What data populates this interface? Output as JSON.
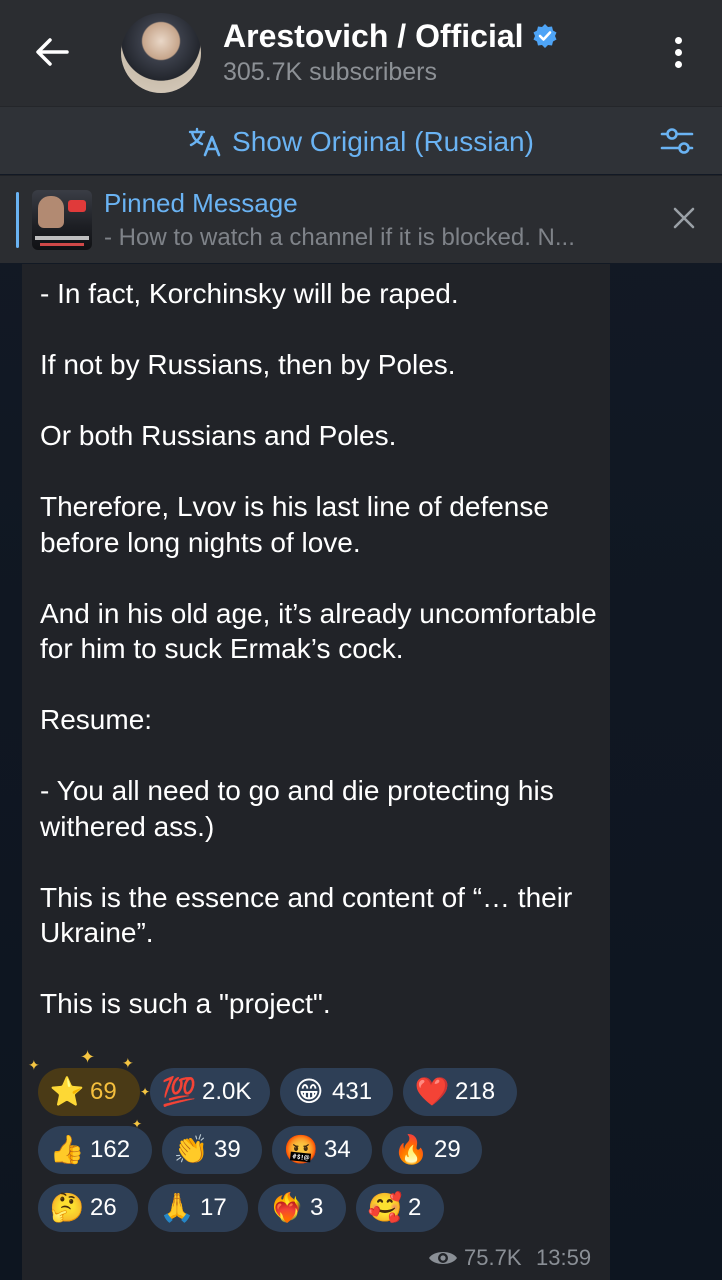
{
  "header": {
    "title": "Arestovich / Official",
    "subscribers": "305.7K subscribers",
    "icons": {
      "back": "arrow-left-icon",
      "verified": "verified-check-icon",
      "menu": "more-vertical-icon"
    }
  },
  "translate_bar": {
    "label": "Show Original (Russian)",
    "icons": {
      "translate": "translate-icon",
      "settings": "sliders-icon"
    }
  },
  "pinned": {
    "title": "Pinned Message",
    "preview": "- How to watch a channel if it is blocked.  N..."
  },
  "message": {
    "paragraphs": [
      "- In fact, Korchinsky will be raped.",
      "If not by Russians, then by Poles.",
      "Or both Russians and Poles.",
      "Therefore, Lvov is his last line of defense before long nights of love.",
      "And in his old age, it’s already uncomfortable for him to suck Ermak’s cock.",
      "Resume:",
      "- You all need to go and die protecting his withered ass.)",
      "This is the essence and content of “… their Ukraine”.",
      "This is such a \"project\"."
    ],
    "reactions": [
      {
        "emoji": "⭐",
        "count": "69",
        "name": "star"
      },
      {
        "emoji": "💯",
        "count": "2.0K",
        "name": "hundred"
      },
      {
        "emoji": "😁",
        "count": "431",
        "name": "grin"
      },
      {
        "emoji": "❤️",
        "count": "218",
        "name": "heart"
      },
      {
        "emoji": "👍",
        "count": "162",
        "name": "thumbs-up"
      },
      {
        "emoji": "👏",
        "count": "39",
        "name": "clap"
      },
      {
        "emoji": "🤬",
        "count": "34",
        "name": "swearing"
      },
      {
        "emoji": "🔥",
        "count": "29",
        "name": "fire"
      },
      {
        "emoji": "🤔",
        "count": "26",
        "name": "thinking"
      },
      {
        "emoji": "🙏",
        "count": "17",
        "name": "pray"
      },
      {
        "emoji": "❤️‍🔥",
        "count": "3",
        "name": "heart-on-fire"
      },
      {
        "emoji": "🥰",
        "count": "2",
        "name": "smiling-hearts"
      }
    ],
    "views": "75.7K",
    "time": "13:59"
  },
  "colors": {
    "accent": "#6ab3f3",
    "header_bg": "#2b2d31",
    "bubble_bg": "#212328",
    "reaction_bg": "#2e3f56",
    "paid_reaction_bg": "#4a3a16",
    "star_color": "#f5bf3d"
  }
}
